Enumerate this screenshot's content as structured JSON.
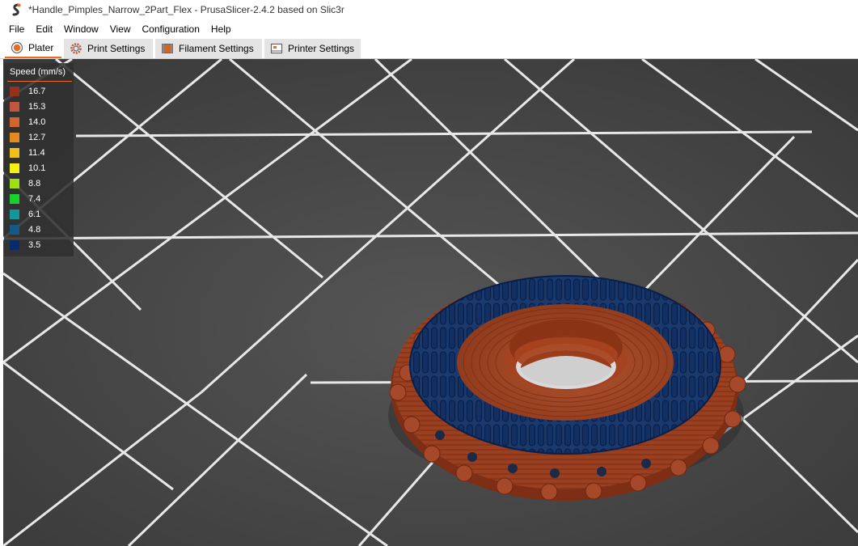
{
  "window": {
    "title": "*Handle_Pimples_Narrow_2Part_Flex - PrusaSlicer-2.4.2 based on Slic3r"
  },
  "menu": [
    "File",
    "Edit",
    "Window",
    "View",
    "Configuration",
    "Help"
  ],
  "tabs": [
    {
      "label": "Plater",
      "icon": "plater-icon",
      "active": true
    },
    {
      "label": "Print Settings",
      "icon": "print-settings-cog-icon",
      "active": false
    },
    {
      "label": "Filament Settings",
      "icon": "filament-spool-icon",
      "active": false
    },
    {
      "label": "Printer Settings",
      "icon": "printer-icon",
      "active": false
    }
  ],
  "legend": {
    "title": "Speed (mm/s)",
    "items": [
      {
        "label": "16.7",
        "color": "#94321c"
      },
      {
        "label": "15.3",
        "color": "#c1563f"
      },
      {
        "label": "14.0",
        "color": "#d0652d"
      },
      {
        "label": "12.7",
        "color": "#e48b20"
      },
      {
        "label": "11.4",
        "color": "#eec218"
      },
      {
        "label": "10.1",
        "color": "#f4ef10"
      },
      {
        "label": "8.8",
        "color": "#9ce012"
      },
      {
        "label": "7.4",
        "color": "#17d12c"
      },
      {
        "label": "6.1",
        "color": "#13989a"
      },
      {
        "label": "4.8",
        "color": "#135a86"
      },
      {
        "label": "3.5",
        "color": "#0b2a6c"
      }
    ]
  },
  "colors": {
    "accent": "#ed6b21",
    "viewport_background": "#3c3c3c",
    "grid": "#ffffff",
    "model_outer": "#94321c",
    "model_inner": "#0b2a6c"
  }
}
